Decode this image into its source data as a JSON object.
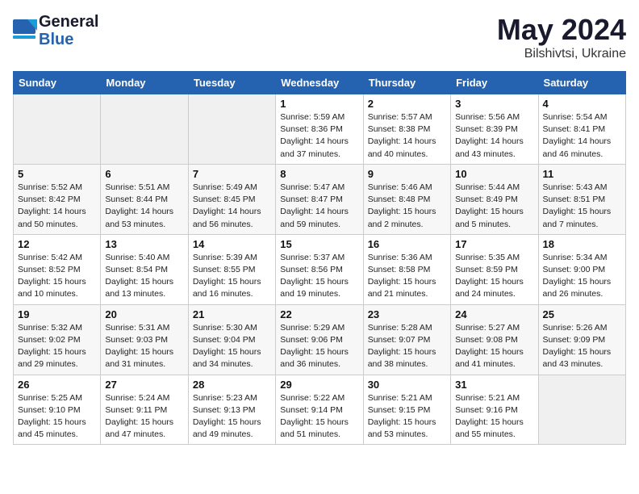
{
  "header": {
    "logo_line1": "General",
    "logo_line2": "Blue",
    "month": "May 2024",
    "location": "Bilshivtsi, Ukraine"
  },
  "weekdays": [
    "Sunday",
    "Monday",
    "Tuesday",
    "Wednesday",
    "Thursday",
    "Friday",
    "Saturday"
  ],
  "weeks": [
    [
      {
        "day": "",
        "detail": ""
      },
      {
        "day": "",
        "detail": ""
      },
      {
        "day": "",
        "detail": ""
      },
      {
        "day": "1",
        "detail": "Sunrise: 5:59 AM\nSunset: 8:36 PM\nDaylight: 14 hours\nand 37 minutes."
      },
      {
        "day": "2",
        "detail": "Sunrise: 5:57 AM\nSunset: 8:38 PM\nDaylight: 14 hours\nand 40 minutes."
      },
      {
        "day": "3",
        "detail": "Sunrise: 5:56 AM\nSunset: 8:39 PM\nDaylight: 14 hours\nand 43 minutes."
      },
      {
        "day": "4",
        "detail": "Sunrise: 5:54 AM\nSunset: 8:41 PM\nDaylight: 14 hours\nand 46 minutes."
      }
    ],
    [
      {
        "day": "5",
        "detail": "Sunrise: 5:52 AM\nSunset: 8:42 PM\nDaylight: 14 hours\nand 50 minutes."
      },
      {
        "day": "6",
        "detail": "Sunrise: 5:51 AM\nSunset: 8:44 PM\nDaylight: 14 hours\nand 53 minutes."
      },
      {
        "day": "7",
        "detail": "Sunrise: 5:49 AM\nSunset: 8:45 PM\nDaylight: 14 hours\nand 56 minutes."
      },
      {
        "day": "8",
        "detail": "Sunrise: 5:47 AM\nSunset: 8:47 PM\nDaylight: 14 hours\nand 59 minutes."
      },
      {
        "day": "9",
        "detail": "Sunrise: 5:46 AM\nSunset: 8:48 PM\nDaylight: 15 hours\nand 2 minutes."
      },
      {
        "day": "10",
        "detail": "Sunrise: 5:44 AM\nSunset: 8:49 PM\nDaylight: 15 hours\nand 5 minutes."
      },
      {
        "day": "11",
        "detail": "Sunrise: 5:43 AM\nSunset: 8:51 PM\nDaylight: 15 hours\nand 7 minutes."
      }
    ],
    [
      {
        "day": "12",
        "detail": "Sunrise: 5:42 AM\nSunset: 8:52 PM\nDaylight: 15 hours\nand 10 minutes."
      },
      {
        "day": "13",
        "detail": "Sunrise: 5:40 AM\nSunset: 8:54 PM\nDaylight: 15 hours\nand 13 minutes."
      },
      {
        "day": "14",
        "detail": "Sunrise: 5:39 AM\nSunset: 8:55 PM\nDaylight: 15 hours\nand 16 minutes."
      },
      {
        "day": "15",
        "detail": "Sunrise: 5:37 AM\nSunset: 8:56 PM\nDaylight: 15 hours\nand 19 minutes."
      },
      {
        "day": "16",
        "detail": "Sunrise: 5:36 AM\nSunset: 8:58 PM\nDaylight: 15 hours\nand 21 minutes."
      },
      {
        "day": "17",
        "detail": "Sunrise: 5:35 AM\nSunset: 8:59 PM\nDaylight: 15 hours\nand 24 minutes."
      },
      {
        "day": "18",
        "detail": "Sunrise: 5:34 AM\nSunset: 9:00 PM\nDaylight: 15 hours\nand 26 minutes."
      }
    ],
    [
      {
        "day": "19",
        "detail": "Sunrise: 5:32 AM\nSunset: 9:02 PM\nDaylight: 15 hours\nand 29 minutes."
      },
      {
        "day": "20",
        "detail": "Sunrise: 5:31 AM\nSunset: 9:03 PM\nDaylight: 15 hours\nand 31 minutes."
      },
      {
        "day": "21",
        "detail": "Sunrise: 5:30 AM\nSunset: 9:04 PM\nDaylight: 15 hours\nand 34 minutes."
      },
      {
        "day": "22",
        "detail": "Sunrise: 5:29 AM\nSunset: 9:06 PM\nDaylight: 15 hours\nand 36 minutes."
      },
      {
        "day": "23",
        "detail": "Sunrise: 5:28 AM\nSunset: 9:07 PM\nDaylight: 15 hours\nand 38 minutes."
      },
      {
        "day": "24",
        "detail": "Sunrise: 5:27 AM\nSunset: 9:08 PM\nDaylight: 15 hours\nand 41 minutes."
      },
      {
        "day": "25",
        "detail": "Sunrise: 5:26 AM\nSunset: 9:09 PM\nDaylight: 15 hours\nand 43 minutes."
      }
    ],
    [
      {
        "day": "26",
        "detail": "Sunrise: 5:25 AM\nSunset: 9:10 PM\nDaylight: 15 hours\nand 45 minutes."
      },
      {
        "day": "27",
        "detail": "Sunrise: 5:24 AM\nSunset: 9:11 PM\nDaylight: 15 hours\nand 47 minutes."
      },
      {
        "day": "28",
        "detail": "Sunrise: 5:23 AM\nSunset: 9:13 PM\nDaylight: 15 hours\nand 49 minutes."
      },
      {
        "day": "29",
        "detail": "Sunrise: 5:22 AM\nSunset: 9:14 PM\nDaylight: 15 hours\nand 51 minutes."
      },
      {
        "day": "30",
        "detail": "Sunrise: 5:21 AM\nSunset: 9:15 PM\nDaylight: 15 hours\nand 53 minutes."
      },
      {
        "day": "31",
        "detail": "Sunrise: 5:21 AM\nSunset: 9:16 PM\nDaylight: 15 hours\nand 55 minutes."
      },
      {
        "day": "",
        "detail": ""
      }
    ]
  ]
}
